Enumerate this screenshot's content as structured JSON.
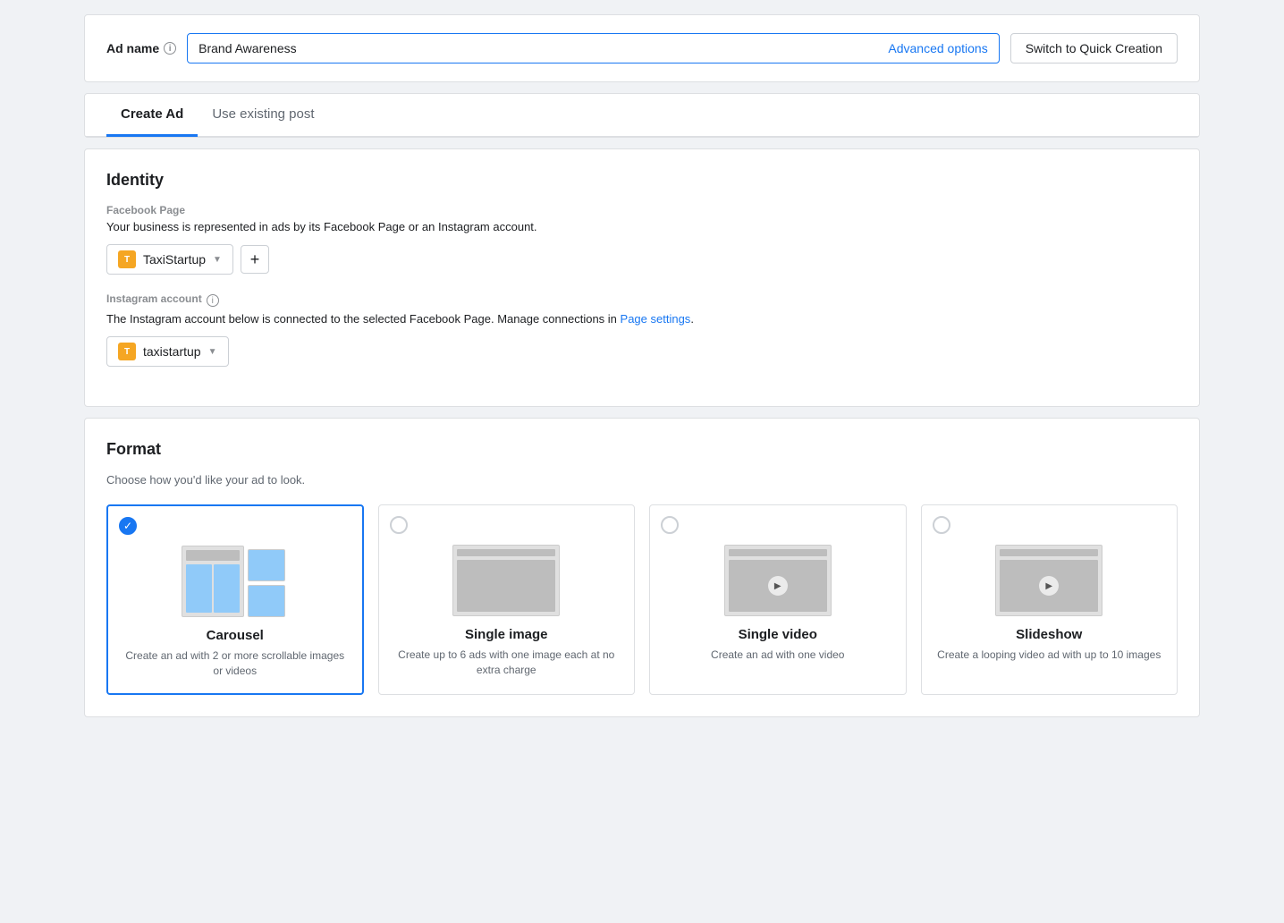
{
  "adName": {
    "label": "Ad name",
    "value": "Brand Awareness",
    "advancedOptions": "Advanced options",
    "switchButton": "Switch to Quick Creation"
  },
  "tabs": {
    "items": [
      {
        "id": "create-ad",
        "label": "Create Ad",
        "active": true
      },
      {
        "id": "use-existing",
        "label": "Use existing post",
        "active": false
      }
    ]
  },
  "identity": {
    "title": "Identity",
    "facebookPage": {
      "label": "Facebook Page",
      "description": "Your business is represented in ads by its Facebook Page or an Instagram account.",
      "pageName": "TaxiStartup"
    },
    "instagramAccount": {
      "label": "Instagram account",
      "description": "The Instagram account below is connected to the selected Facebook Page. Manage connections in ",
      "pageSettingsLink": "Page settings",
      "pageSuffix": ".",
      "accountName": "taxistartup"
    }
  },
  "format": {
    "title": "Format",
    "description": "Choose how you'd like your ad to look.",
    "options": [
      {
        "id": "carousel",
        "name": "Carousel",
        "description": "Create an ad with 2 or more scrollable images or videos",
        "selected": true
      },
      {
        "id": "single-image",
        "name": "Single image",
        "description": "Create up to 6 ads with one image each at no extra charge",
        "selected": false
      },
      {
        "id": "single-video",
        "name": "Single video",
        "description": "Create an ad with one video",
        "selected": false
      },
      {
        "id": "slideshow",
        "name": "Slideshow",
        "description": "Create a looping video ad with up to 10 images",
        "selected": false
      }
    ]
  }
}
